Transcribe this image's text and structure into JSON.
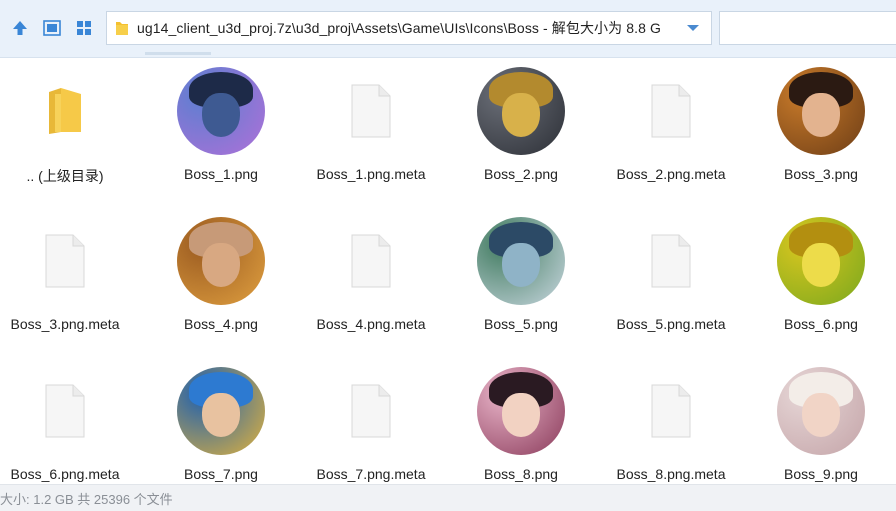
{
  "toolbar": {
    "address_path": "ug14_client_u3d_proj.7z\\u3d_proj\\Assets\\Game\\UIs\\Icons\\Boss - 解包大小为 8.8 G",
    "search_placeholder": ""
  },
  "files": [
    {
      "name": ".. (上级目录)",
      "kind": "folder"
    },
    {
      "name": "Boss_1.png",
      "kind": "image",
      "palette": {
        "bg": "#5a7fd0",
        "bg2": "#b070d8",
        "hair": "#1d2a48",
        "face": "#3e5a92"
      }
    },
    {
      "name": "Boss_1.png.meta",
      "kind": "file"
    },
    {
      "name": "Boss_2.png",
      "kind": "image",
      "palette": {
        "bg": "#6b6f78",
        "bg2": "#2c2f36",
        "hair": "#b38a2e",
        "face": "#d8b14a"
      }
    },
    {
      "name": "Boss_2.png.meta",
      "kind": "file"
    },
    {
      "name": "Boss_3.png",
      "kind": "image",
      "palette": {
        "bg": "#c97b2a",
        "bg2": "#6d3d16",
        "hair": "#2b1a12",
        "face": "#e3b38f"
      }
    },
    {
      "name": "Boss_3.png.meta",
      "kind": "file"
    },
    {
      "name": "Boss_4.png",
      "kind": "image",
      "palette": {
        "bg": "#9a5a20",
        "bg2": "#e0a040",
        "hair": "#c79a78",
        "face": "#d8a882"
      }
    },
    {
      "name": "Boss_4.png.meta",
      "kind": "file"
    },
    {
      "name": "Boss_5.png",
      "kind": "image",
      "palette": {
        "bg": "#3f7a5e",
        "bg2": "#c9d7e0",
        "hair": "#2c4a66",
        "face": "#8fb3c7"
      }
    },
    {
      "name": "Boss_5.png.meta",
      "kind": "file"
    },
    {
      "name": "Boss_6.png",
      "kind": "image",
      "palette": {
        "bg": "#d9c61f",
        "bg2": "#7aa81e",
        "hair": "#b38f10",
        "face": "#eddc4a"
      }
    },
    {
      "name": "Boss_6.png.meta",
      "kind": "file"
    },
    {
      "name": "Boss_7.png",
      "kind": "image",
      "palette": {
        "bg": "#1d5fb0",
        "bg2": "#e2b33c",
        "hair": "#2d7ad1",
        "face": "#e8c2a0"
      }
    },
    {
      "name": "Boss_7.png.meta",
      "kind": "file"
    },
    {
      "name": "Boss_8.png",
      "kind": "image",
      "palette": {
        "bg": "#e8b4c8",
        "bg2": "#8a3a5a",
        "hair": "#2a1a22",
        "face": "#f2d2c2"
      }
    },
    {
      "name": "Boss_8.png.meta",
      "kind": "file"
    },
    {
      "name": "Boss_9.png",
      "kind": "image",
      "palette": {
        "bg": "#e6d6d6",
        "bg2": "#c4a4a8",
        "hair": "#f3ede8",
        "face": "#f1d4c6"
      }
    }
  ],
  "status": {
    "text": "大小: 1.2 GB 共 25396 个文件"
  }
}
